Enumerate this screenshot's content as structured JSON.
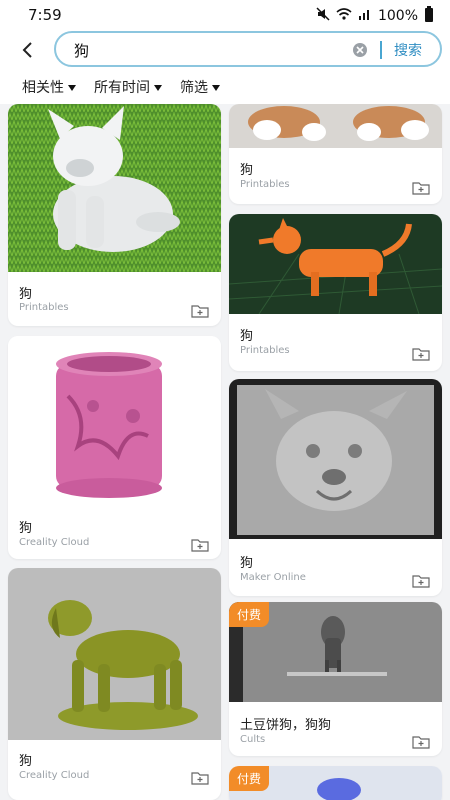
{
  "status": {
    "time": "7:59",
    "battery": "100%"
  },
  "search": {
    "query": "狗",
    "button": "搜索"
  },
  "filters": [
    {
      "label": "相关性"
    },
    {
      "label": "所有时间"
    },
    {
      "label": "筛选"
    }
  ],
  "cards": [
    {
      "title": "狗",
      "source": "Printables",
      "image": "white dog statue on grass",
      "paid": ""
    },
    {
      "title": "狗",
      "source": "Creality Cloud",
      "image": "pink carved pencil cup",
      "paid": ""
    },
    {
      "title": "狗",
      "source": "Creality Cloud",
      "image": "olive green dog sculpture",
      "paid": ""
    },
    {
      "title": "狗",
      "source": "Printables",
      "image": "cartoon dog paws",
      "paid": ""
    },
    {
      "title": "狗",
      "source": "Printables",
      "image": "orange cat figure",
      "paid": ""
    },
    {
      "title": "狗",
      "source": "Maker Online",
      "image": "relief dog face",
      "paid": ""
    },
    {
      "title": "土豆饼狗，狗狗",
      "source": "Cults",
      "image": "small dog model in viewer",
      "paid": "付费"
    },
    {
      "title": "",
      "source": "",
      "image": "blue figure",
      "paid": "付费"
    }
  ]
}
